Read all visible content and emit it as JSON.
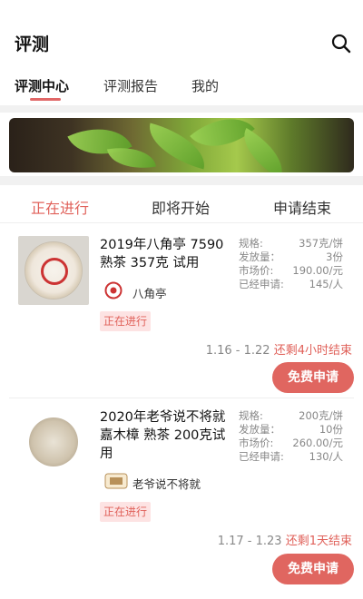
{
  "header": {
    "title": "评测",
    "search_icon": "search-icon"
  },
  "tabs": [
    {
      "label": "评测中心",
      "active": true
    },
    {
      "label": "评测报告",
      "active": false
    },
    {
      "label": "我的",
      "active": false
    }
  ],
  "filters": [
    {
      "label": "正在进行",
      "active": true
    },
    {
      "label": "即将开始",
      "active": false
    },
    {
      "label": "申请结束",
      "active": false
    }
  ],
  "colors": {
    "accent": "#e0615a",
    "badge_bg": "#fde3e3"
  },
  "items": [
    {
      "title": "2019年八角亭 7590熟茶 357克 试用",
      "brand": "八角亭",
      "status": "正在进行",
      "specs": [
        {
          "label": "规格:",
          "value": "357克/饼"
        },
        {
          "label": "发放量：",
          "value": "3份"
        },
        {
          "label": "市场价:",
          "value": "190.00/元"
        },
        {
          "label": "已经申请:",
          "value": "145/人"
        }
      ],
      "dates": "1.16 - 1.22",
      "remaining": "还剩4小时结束",
      "button": "免费申请"
    },
    {
      "title": "2020年老爷说不将就嘉木樟 熟茶 200克试用",
      "brand": "老爷说不将就",
      "status": "正在进行",
      "specs": [
        {
          "label": "规格:",
          "value": "200克/饼"
        },
        {
          "label": "发放量：",
          "value": "10份"
        },
        {
          "label": "市场价:",
          "value": "260.00/元"
        },
        {
          "label": "已经申请:",
          "value": "130/人"
        }
      ],
      "dates": "1.17 - 1.23",
      "remaining": "还剩1天结束",
      "button": "免费申请"
    }
  ]
}
